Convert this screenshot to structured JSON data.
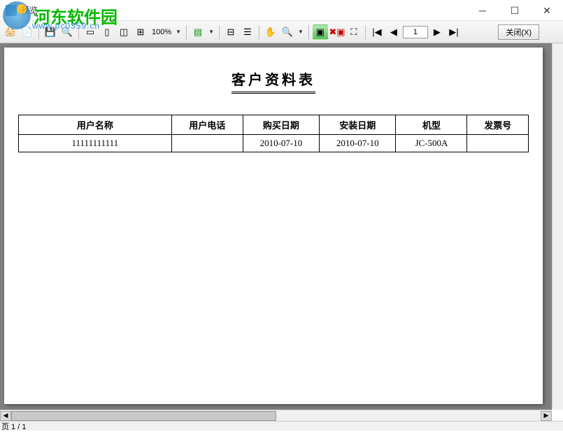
{
  "window": {
    "title": "预览"
  },
  "watermark": {
    "text": "河东软件园",
    "url": "www.pc0359.cn"
  },
  "toolbar": {
    "zoom": "100%",
    "page_current": "1",
    "close_label": "关闭(X)"
  },
  "document": {
    "title": "客户资料表",
    "headers": {
      "name": "用户名称",
      "phone": "用户电话",
      "buy_date": "购买日期",
      "install_date": "安装日期",
      "model": "机型",
      "invoice": "发票号"
    },
    "rows": [
      {
        "name": "11111111111",
        "phone": "",
        "buy_date": "2010-07-10",
        "install_date": "2010-07-10",
        "model": "JC-500A",
        "invoice": ""
      }
    ]
  },
  "status": {
    "page_label": "页 1 / 1"
  }
}
